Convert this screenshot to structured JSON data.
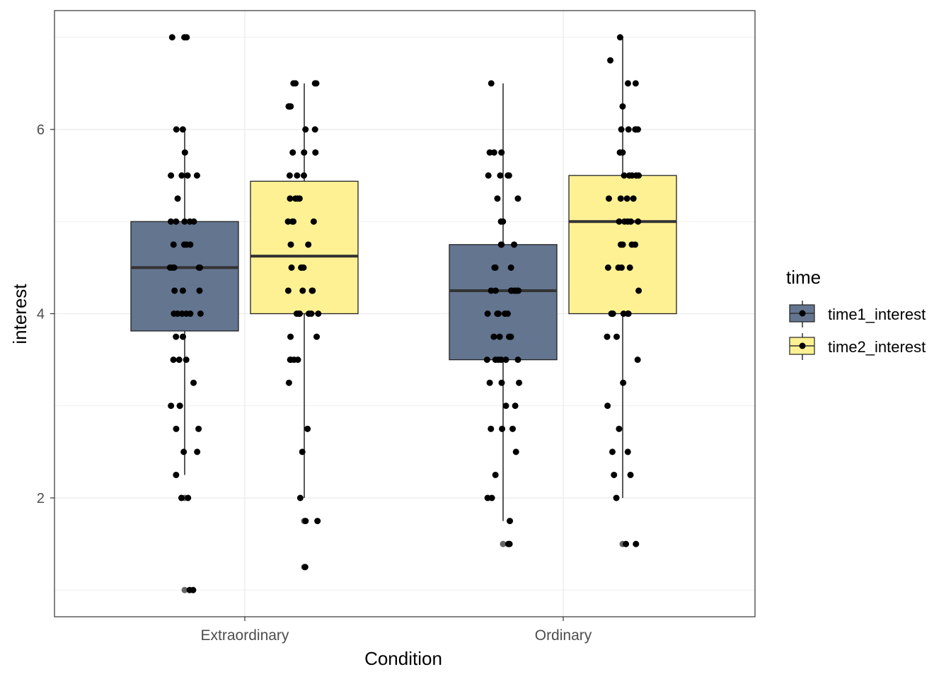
{
  "chart_data": {
    "type": "boxplot",
    "xlabel": "Condition",
    "ylabel": "interest",
    "categories": [
      "Extraordinary",
      "Ordinary"
    ],
    "yticks": [
      2,
      4,
      6
    ],
    "ylim": [
      0.85,
      7.3
    ],
    "grid": true,
    "legend": {
      "title": "time",
      "position": "right",
      "entries": [
        "time1_interest",
        "time2_interest"
      ]
    },
    "series": [
      {
        "name": "time1_interest",
        "color": "#63758f",
        "boxes": [
          {
            "category": "Extraordinary",
            "lower_whisker": 2.25,
            "q1": 3.8125,
            "median": 4.5,
            "q3": 5.0,
            "upper_whisker": 6.0,
            "outliers": [
              7,
              2,
              1
            ]
          },
          {
            "category": "Ordinary",
            "lower_whisker": 1.75,
            "q1": 3.5,
            "median": 4.25,
            "q3": 4.75,
            "upper_whisker": 6.5,
            "outliers": [
              1.5
            ]
          }
        ],
        "points": [
          [
            7,
            7,
            7,
            6,
            6,
            5.75,
            5.5,
            5.5,
            5.5,
            5.5,
            5.25,
            5,
            5,
            5,
            5,
            5,
            4.75,
            4.75,
            4.75,
            4.75,
            4.5,
            4.5,
            4.5,
            4.5,
            4.5,
            4.25,
            4.25,
            4.25,
            4,
            4,
            4,
            4,
            4,
            4,
            3.75,
            3.75,
            3.5,
            3.5,
            3.5,
            3.25,
            3,
            3,
            3,
            2.75,
            2.75,
            2.5,
            2.5,
            2.25,
            2,
            2,
            1,
            1
          ],
          [
            6.5,
            5.75,
            5.75,
            5.75,
            5.5,
            5.5,
            5.5,
            5.5,
            5.25,
            5.25,
            5,
            5,
            5,
            4.75,
            4.75,
            4.75,
            4.5,
            4.5,
            4.5,
            4.25,
            4.25,
            4.25,
            4.25,
            4.25,
            4.25,
            4.25,
            4.25,
            4,
            4,
            4,
            4,
            4,
            3.75,
            3.75,
            3.75,
            3.75,
            3.5,
            3.5,
            3.5,
            3.5,
            3.5,
            3.5,
            3.25,
            3.25,
            3.25,
            3,
            3,
            2.75,
            2.75,
            2.75,
            2.5,
            2.25,
            2,
            2,
            1.75,
            1.5,
            1.5
          ]
        ]
      },
      {
        "name": "time2_interest",
        "color": "#fef193",
        "boxes": [
          {
            "category": "Extraordinary",
            "lower_whisker": 2.0,
            "q1": 4.0,
            "median": 4.625,
            "q3": 5.4375,
            "upper_whisker": 6.5,
            "outliers": [
              1.75,
              1.25
            ]
          },
          {
            "category": "Ordinary",
            "lower_whisker": 2.0,
            "q1": 4.0,
            "median": 5.0,
            "q3": 5.5,
            "upper_whisker": 7.0,
            "outliers": [
              1.5
            ]
          }
        ],
        "points": [
          [
            6.5,
            6.5,
            6.5,
            6.5,
            6.25,
            6.25,
            6.25,
            6,
            6,
            5.75,
            5.75,
            5.75,
            5.5,
            5.5,
            5.5,
            5.25,
            5.25,
            5.25,
            5.25,
            5,
            5,
            5,
            5,
            4.75,
            4.75,
            4.5,
            4.5,
            4.5,
            4.5,
            4.25,
            4.25,
            4.25,
            4.25,
            4,
            4,
            4,
            4,
            4,
            4,
            3.75,
            3.75,
            3.5,
            3.5,
            3.5,
            3.5,
            3.25,
            2.75,
            2.5,
            2,
            1.75,
            1.75,
            1.25
          ],
          [
            7,
            6.75,
            6.5,
            6.5,
            6.25,
            6,
            6,
            6,
            6,
            6,
            5.75,
            5.75,
            5.5,
            5.5,
            5.5,
            5.5,
            5.5,
            5.25,
            5.25,
            5.25,
            5.25,
            5,
            5,
            5,
            5,
            5,
            4.75,
            4.75,
            4.75,
            4.75,
            4.5,
            4.5,
            4.5,
            4.5,
            4.25,
            4,
            4,
            4,
            4,
            4,
            4,
            3.75,
            3.75,
            3.5,
            3.25,
            3,
            2.75,
            2.5,
            2.5,
            2.25,
            2.25,
            2,
            1.5,
            1.5
          ]
        ]
      }
    ]
  }
}
